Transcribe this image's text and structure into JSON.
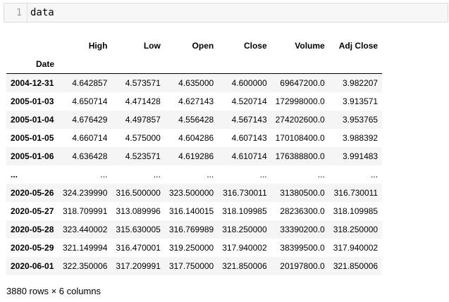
{
  "cell": {
    "line_number": "1",
    "code": "data"
  },
  "dataframe": {
    "index_name": "Date",
    "columns": [
      "High",
      "Low",
      "Open",
      "Close",
      "Volume",
      "Adj Close"
    ],
    "rows": [
      {
        "index": "2004-12-31",
        "values": [
          "4.642857",
          "4.573571",
          "4.635000",
          "4.600000",
          "69647200.0",
          "3.982207"
        ]
      },
      {
        "index": "2005-01-03",
        "values": [
          "4.650714",
          "4.471428",
          "4.627143",
          "4.520714",
          "172998000.0",
          "3.913571"
        ]
      },
      {
        "index": "2005-01-04",
        "values": [
          "4.676429",
          "4.497857",
          "4.556428",
          "4.567143",
          "274202600.0",
          "3.953765"
        ]
      },
      {
        "index": "2005-01-05",
        "values": [
          "4.660714",
          "4.575000",
          "4.604286",
          "4.607143",
          "170108400.0",
          "3.988392"
        ]
      },
      {
        "index": "2005-01-06",
        "values": [
          "4.636428",
          "4.523571",
          "4.619286",
          "4.610714",
          "176388800.0",
          "3.991483"
        ]
      },
      {
        "index": "...",
        "values": [
          "...",
          "...",
          "...",
          "...",
          "...",
          "..."
        ]
      },
      {
        "index": "2020-05-26",
        "values": [
          "324.239990",
          "316.500000",
          "323.500000",
          "316.730011",
          "31380500.0",
          "316.730011"
        ]
      },
      {
        "index": "2020-05-27",
        "values": [
          "318.709991",
          "313.089996",
          "316.140015",
          "318.109985",
          "28236300.0",
          "318.109985"
        ]
      },
      {
        "index": "2020-05-28",
        "values": [
          "323.440002",
          "315.630005",
          "316.769989",
          "318.250000",
          "33390200.0",
          "318.250000"
        ]
      },
      {
        "index": "2020-05-29",
        "values": [
          "321.149994",
          "316.470001",
          "319.250000",
          "317.940002",
          "38399500.0",
          "317.940002"
        ]
      },
      {
        "index": "2020-06-01",
        "values": [
          "322.350006",
          "317.209991",
          "317.750000",
          "321.850006",
          "20197800.0",
          "321.850006"
        ]
      }
    ],
    "shape_text": "3880 rows × 6 columns"
  }
}
